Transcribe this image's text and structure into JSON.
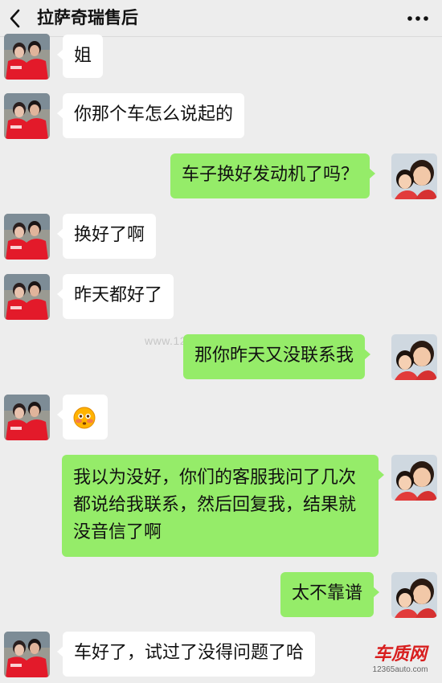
{
  "header": {
    "title": "拉萨奇瑞售后",
    "back_icon": "chevron-left-icon",
    "more_icon": "more-dots-icon"
  },
  "messages": [
    {
      "side": "left",
      "text": "姐"
    },
    {
      "side": "left",
      "text": "你那个车怎么说起的"
    },
    {
      "side": "right",
      "text": "车子换好发动机了吗？"
    },
    {
      "side": "left",
      "text": "换好了啊"
    },
    {
      "side": "left",
      "text": "昨天都好了"
    },
    {
      "side": "right",
      "text": "那你昨天又没联系我"
    },
    {
      "side": "left",
      "emoji": "flushed-face-emoji"
    },
    {
      "side": "right",
      "text": "我以为没好，你们的客服我问了几次都说给我联系，然后回复我，结果就没音信了啊"
    },
    {
      "side": "right",
      "text": "太不靠谱"
    },
    {
      "side": "left",
      "text": "车好了，试过了没得问题了哈"
    }
  ],
  "watermark": "www.12365auto.com",
  "logo": {
    "name": "车质网",
    "url": "12365auto.com"
  },
  "colors": {
    "background": "#ededed",
    "bubble_self": "#95ec69",
    "bubble_other": "#ffffff",
    "logo_red": "#d81e1e"
  }
}
